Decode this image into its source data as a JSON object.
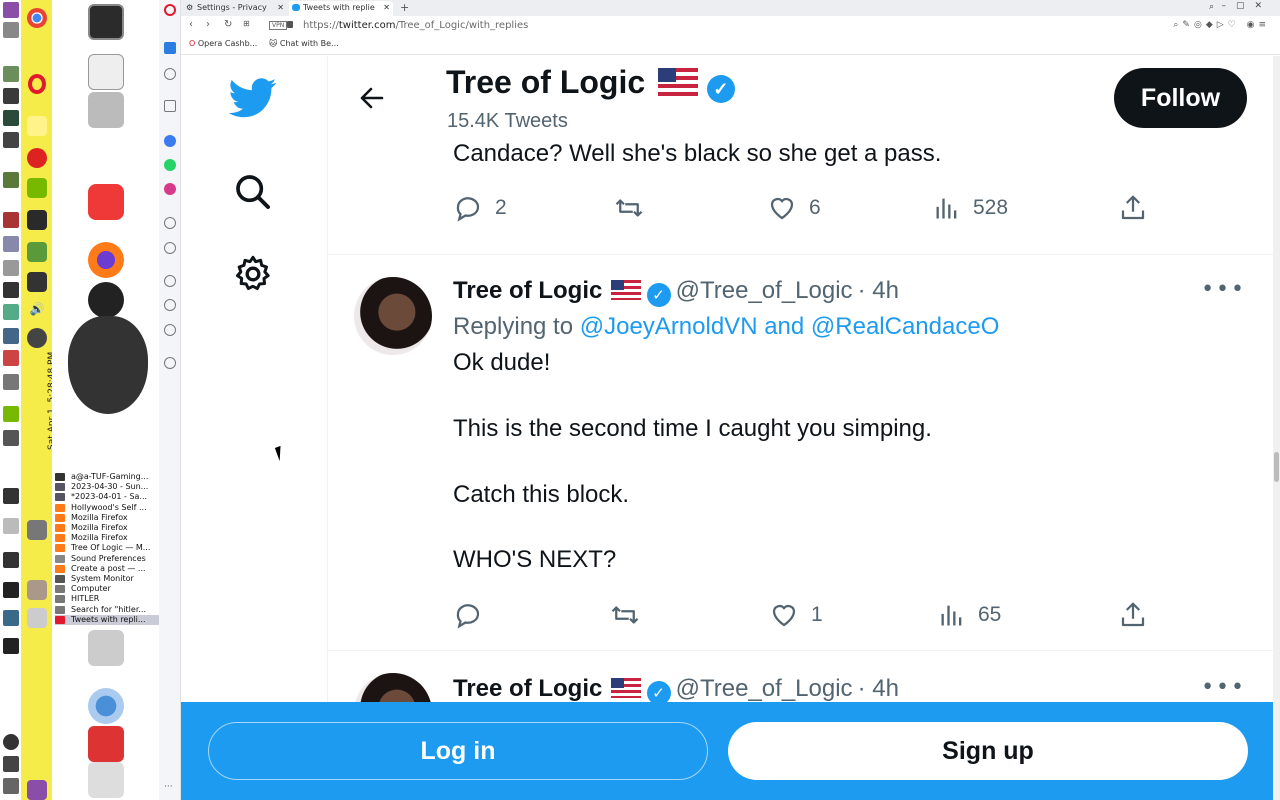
{
  "system_panel": {
    "clock": "Sat Apr 1,  5:28:48 PM"
  },
  "tasklist": [
    {
      "label": "a@a-TUF-Gaming...",
      "active": false
    },
    {
      "label": "2023-04-30 - Sun...",
      "active": false
    },
    {
      "label": "*2023-04-01 - Sa...",
      "active": false
    },
    {
      "label": "Hollywood's Self ...",
      "active": false
    },
    {
      "label": "Mozilla Firefox",
      "active": false
    },
    {
      "label": "Mozilla Firefox",
      "active": false
    },
    {
      "label": "Mozilla Firefox",
      "active": false
    },
    {
      "label": "Tree Of Logic — M...",
      "active": false
    },
    {
      "label": "Sound Preferences",
      "active": false
    },
    {
      "label": "Create a post — ...",
      "active": false
    },
    {
      "label": "System Monitor",
      "active": false
    },
    {
      "label": "Computer",
      "active": false
    },
    {
      "label": "HITLER",
      "active": false
    },
    {
      "label": "Search for \"hitler...",
      "active": false
    },
    {
      "label": "Tweets with repli...",
      "active": true
    }
  ],
  "browser": {
    "tabs": [
      {
        "label": "Settings - Privacy",
        "active": false
      },
      {
        "label": "Tweets with replie",
        "active": true
      }
    ],
    "new_tab": "+",
    "url_prefix": "https://",
    "url_host": "twitter.com",
    "url_path": "/Tree_of_Logic/with_replies",
    "bookmarks": [
      "Opera Cashb...",
      "Chat with Be..."
    ]
  },
  "profile_header": {
    "name": "Tree of Logic",
    "flag": "🇺🇸",
    "tweet_count": "15.4K Tweets",
    "follow_label": "Follow"
  },
  "tweet1": {
    "partial_text": "Candace?  Well she's black so she get a pass.",
    "replies": "2",
    "retweets": "",
    "likes": "6",
    "views": "528"
  },
  "tweet2": {
    "name": "Tree of Logic",
    "flag": "🇺🇸",
    "handle": "@Tree_of_Logic",
    "time": "· 4h",
    "replying_prefix": "Replying to ",
    "replying_to": "@JoeyArnoldVN and @RealCandaceO",
    "lines": [
      "Ok dude!",
      "This is the second time I caught you simping.",
      "Catch this block.",
      "WHO'S NEXT?"
    ],
    "replies": "",
    "retweets": "",
    "likes": "1",
    "views": "65"
  },
  "tweet3": {
    "name": "Tree of Logic",
    "flag": "🇺🇸",
    "handle": "@Tree_of_Logic",
    "time": "· 4h"
  },
  "bottom_bar": {
    "login_label": "Log in",
    "signup_label": "Sign up"
  },
  "colors": {
    "twitter_blue": "#1d9bf0",
    "text_primary": "#0f1419",
    "text_secondary": "#536471",
    "panel_yellow": "#f5ec4a"
  }
}
